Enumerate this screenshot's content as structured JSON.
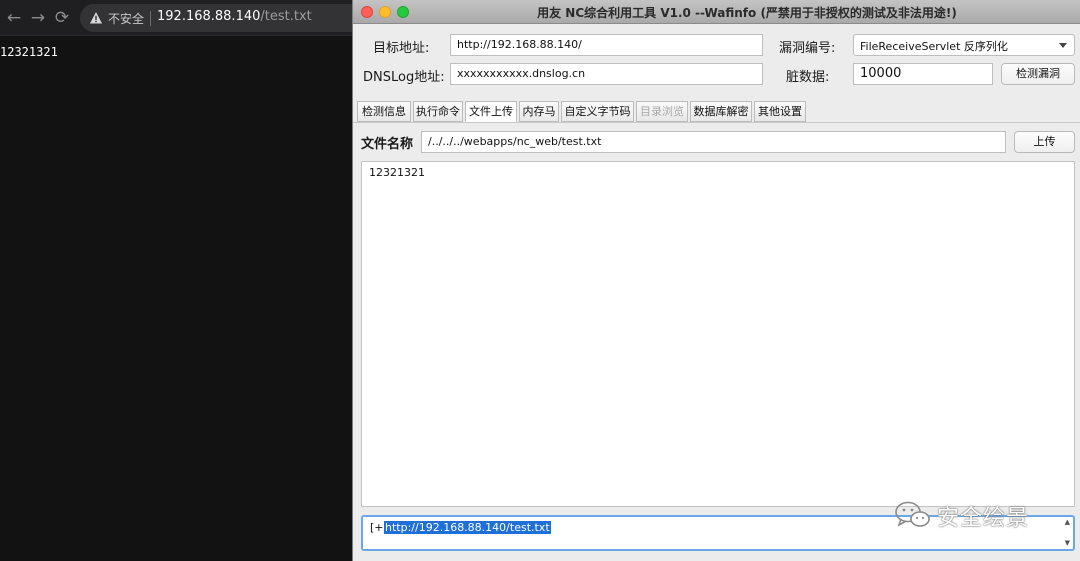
{
  "browser": {
    "back_glyph": "←",
    "forward_glyph": "→",
    "reload_glyph": "⟳",
    "security_label": "不安全",
    "url_host": "192.168.88.140",
    "url_path": "/test.txt",
    "page_content": "12321321"
  },
  "tool": {
    "title": "用友 NC综合利用工具 V1.0 --Wafinfo (严禁用于非授权的测试及非法用途!)",
    "target_label": "目标地址:",
    "target_value": "http://192.168.88.140/",
    "vuln_label": "漏洞编号:",
    "vuln_value": "FileReceiveServlet 反序列化",
    "dnslog_label": "DNSLog地址:",
    "dnslog_value": "xxxxxxxxxxx.dnslog.cn",
    "dirty_label": "脏数据:",
    "dirty_value": "10000",
    "check_button": "检测漏洞",
    "tabs": [
      {
        "label": "检测信息"
      },
      {
        "label": "执行命令"
      },
      {
        "label": "文件上传"
      },
      {
        "label": "内存马"
      },
      {
        "label": "自定义字节码"
      },
      {
        "label": "目录浏览"
      },
      {
        "label": "数据库解密"
      },
      {
        "label": "其他设置"
      }
    ],
    "upload": {
      "filename_label": "文件名称",
      "filename_value": "/../../../webapps/nc_web/test.txt",
      "upload_button": "上传",
      "content": "12321321"
    },
    "log": {
      "prefix": "[+]",
      "url": "http://192.168.88.140/test.txt"
    },
    "scroll_up": "▲",
    "scroll_down": "▼"
  },
  "watermark": {
    "text": "安全绘景"
  },
  "colors": {
    "accent": "#1f6fd8",
    "focus_border": "#6aa7e8",
    "browser_bg": "#121212"
  }
}
